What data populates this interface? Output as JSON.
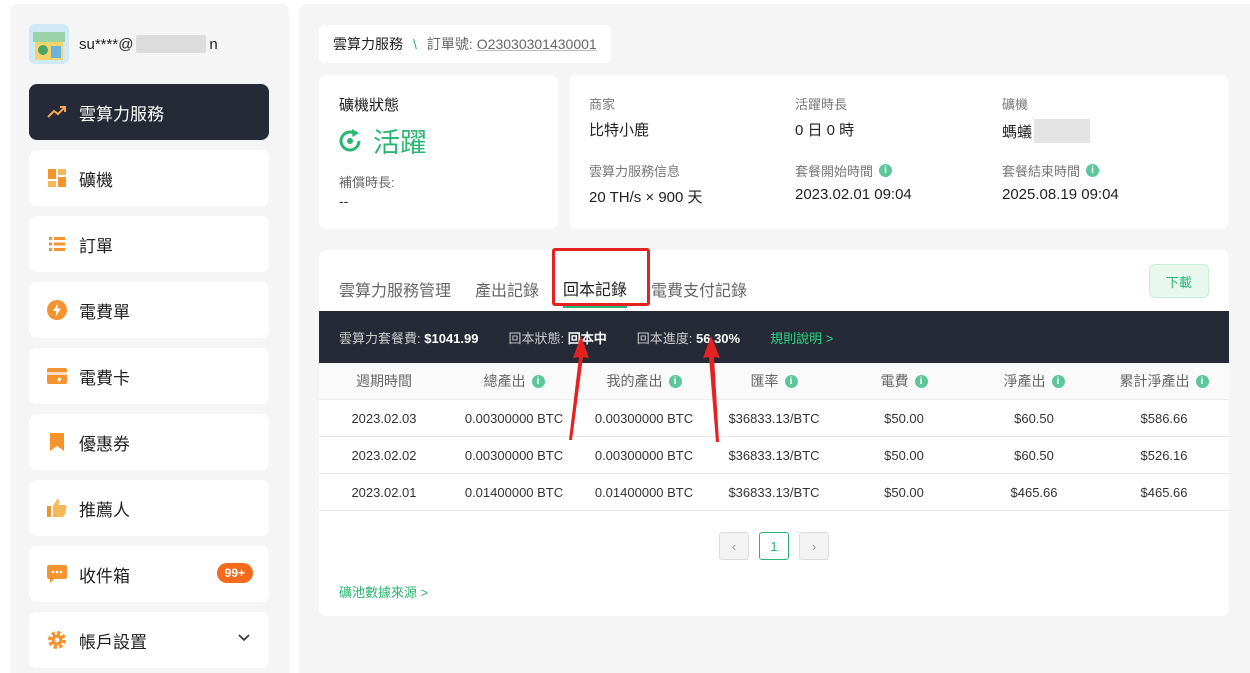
{
  "user": {
    "email_prefix": "su****@",
    "email_suffix": "n"
  },
  "sidebar": {
    "items": [
      {
        "label": "雲算力服務",
        "icon": "trend-icon"
      },
      {
        "label": "礦機",
        "icon": "grid-icon"
      },
      {
        "label": "訂單",
        "icon": "list-icon"
      },
      {
        "label": "電費單",
        "icon": "bolt-icon"
      },
      {
        "label": "電費卡",
        "icon": "card-icon"
      },
      {
        "label": "優惠券",
        "icon": "bookmark-icon"
      },
      {
        "label": "推薦人",
        "icon": "thumbs-up-icon"
      },
      {
        "label": "收件箱",
        "icon": "chat-icon",
        "badge": "99+"
      },
      {
        "label": "帳戶設置",
        "icon": "gear-icon"
      }
    ]
  },
  "breadcrumb": {
    "section": "雲算力服務",
    "sep": "\\",
    "order_label": "訂單號:",
    "order_no": "O23030301430001"
  },
  "status": {
    "title": "礦機狀態",
    "value": "活躍",
    "comp_label": "補償時長:",
    "comp_value": "--"
  },
  "info": {
    "merchant_label": "商家",
    "merchant_value": "比特小鹿",
    "active_label": "活躍時長",
    "active_value": "0 日 0 時",
    "miner_label": "礦機",
    "miner_value": "螞蟻",
    "service_label": "雲算力服務信息",
    "service_value": "20 TH/s × 900 天",
    "start_label": "套餐開始時間",
    "start_value": "2023.02.01 09:04",
    "end_label": "套餐結束時間",
    "end_value": "2025.08.19 09:04"
  },
  "tabs": [
    "雲算力服務管理",
    "產出記錄",
    "回本記錄",
    "電費支付記錄"
  ],
  "download_label": "下載",
  "summary": {
    "fee_label": "雲算力套餐費:",
    "fee_value": "$1041.99",
    "status_label": "回本狀態:",
    "status_value": "回本中",
    "progress_label": "回本進度:",
    "progress_value": "56.30%",
    "rule_link": "規則說明 >"
  },
  "table": {
    "headers": [
      "週期時間",
      "總產出",
      "我的產出",
      "匯率",
      "電費",
      "淨產出",
      "累計淨產出"
    ],
    "rows": [
      [
        "2023.02.03",
        "0.00300000 BTC",
        "0.00300000 BTC",
        "$36833.13/BTC",
        "$50.00",
        "$60.50",
        "$586.66"
      ],
      [
        "2023.02.02",
        "0.00300000 BTC",
        "0.00300000 BTC",
        "$36833.13/BTC",
        "$50.00",
        "$60.50",
        "$526.16"
      ],
      [
        "2023.02.01",
        "0.01400000 BTC",
        "0.01400000 BTC",
        "$36833.13/BTC",
        "$50.00",
        "$465.66",
        "$465.66"
      ]
    ]
  },
  "pager": {
    "prev": "‹",
    "page": "1",
    "next": "›"
  },
  "source_link": "礦池數據來源 >",
  "colors": {
    "accent": "#2bb673",
    "dark": "#262a36",
    "red": "#e52222",
    "badge": "#f26b1d"
  }
}
